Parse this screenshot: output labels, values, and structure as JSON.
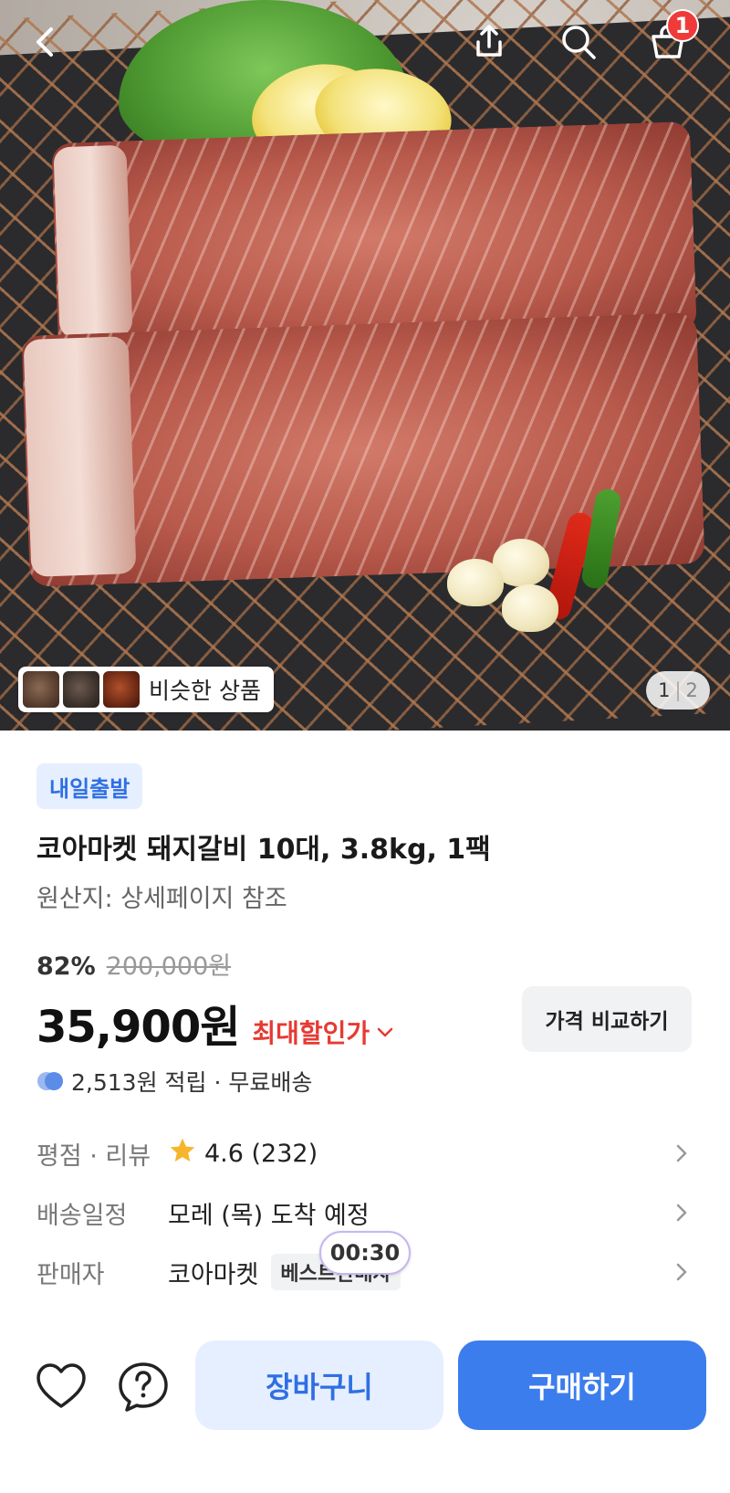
{
  "nav": {
    "back_icon": "chevron-left-icon",
    "share_icon": "share-icon",
    "search_icon": "search-icon",
    "cart_icon": "shopping-bag-icon",
    "cart_count": "1"
  },
  "gallery": {
    "similar_label": "비슷한 상품",
    "page_current": "1",
    "page_total": "2"
  },
  "product": {
    "shipping_badge": "내일출발",
    "title": "코아마켓 돼지갈비 10대, 3.8kg, 1팩",
    "origin": "원산지: 상세페이지 참조",
    "discount_rate": "82%",
    "original_price": "200,000원",
    "price": "35,900원",
    "max_discount_label": "최대할인가",
    "compare_button": "가격 비교하기",
    "reward_text": "2,513원 적립 · 무료배송"
  },
  "info": {
    "rating_label": "평점 · 리뷰",
    "rating_value": "4.6 (232)",
    "delivery_label": "배송일정",
    "delivery_value": "모레 (목) 도착 예정",
    "seller_label": "판매자",
    "seller_value": "코아마켓",
    "seller_tag": "베스트판매자",
    "timer": "00:30"
  },
  "actions": {
    "cart_button": "장바구니",
    "buy_button": "구매하기"
  },
  "colors": {
    "accent_blue": "#3b7ded",
    "light_blue": "#e6efff",
    "sale_red": "#e63a32",
    "badge_red": "#f03a3a",
    "star_yellow": "#f7b52c"
  }
}
